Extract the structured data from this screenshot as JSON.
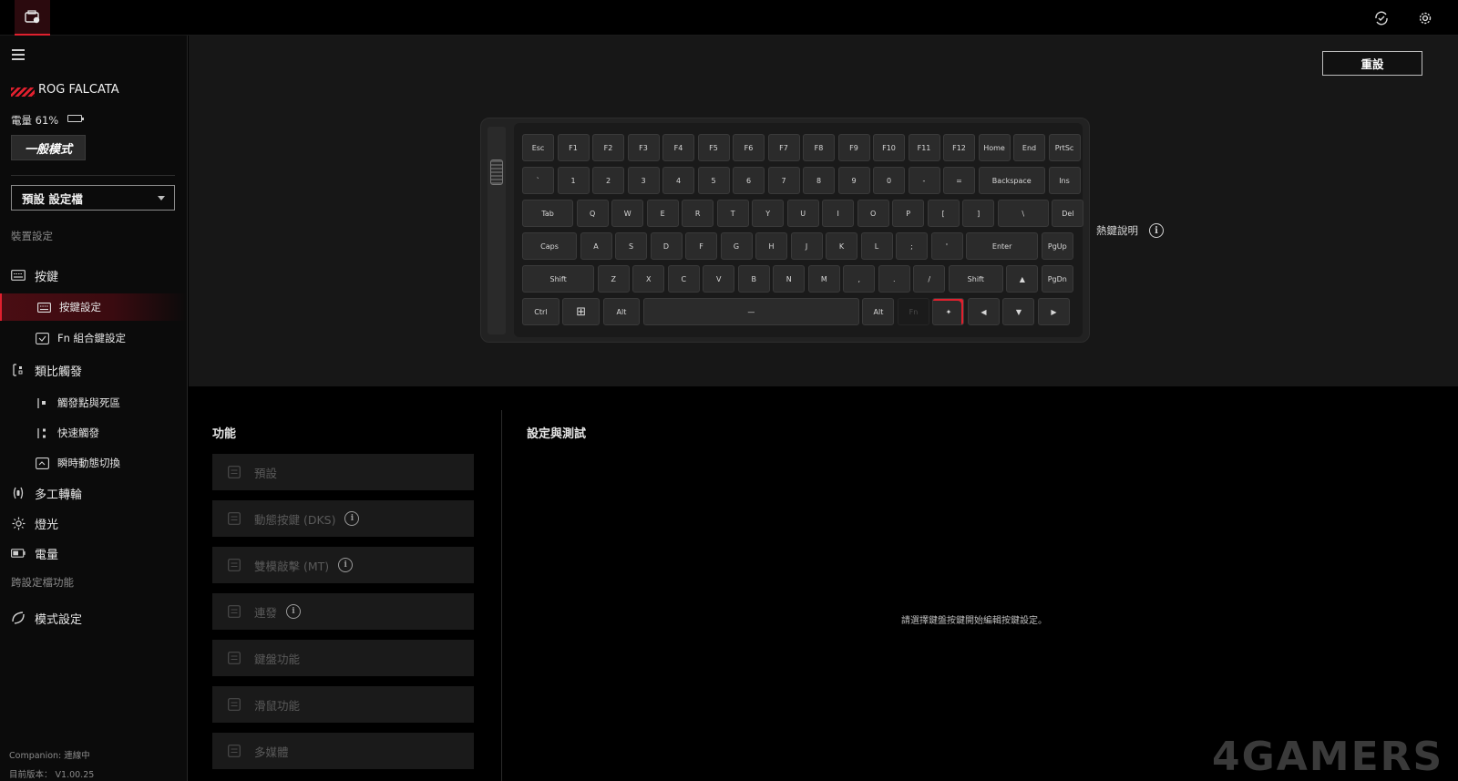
{
  "topbar": {
    "app_icon": "device-icon",
    "sync_icon": "sync-check-icon",
    "settings_icon": "gear-icon"
  },
  "sidebar": {
    "device_name": "ROG FALCATA",
    "battery_label": "電量 61%",
    "mode_button": "一般模式",
    "profile": "預設 設定檔",
    "section_device": "裝置設定",
    "nav": {
      "keys": "按鍵",
      "key_settings": "按鍵設定",
      "fn_combo": "Fn 組合鍵設定",
      "analog": "類比觸發",
      "trigger_deadzone": "觸發點與死區",
      "rapid_trigger": "快速觸發",
      "dynamic_switch": "瞬時動態切換",
      "multi_wheel": "多工轉輪",
      "lighting": "燈光",
      "power": "電量"
    },
    "section_cross": "跨設定檔功能",
    "mode_settings": "模式設定",
    "companion": "Companion: 連線中",
    "version": "目前版本： V1.00.25"
  },
  "keyboard": {
    "reset_label": "重設",
    "hotkey_help": "熱鍵說明",
    "rows": [
      [
        "Esc",
        "F1",
        "F2",
        "F3",
        "F4",
        "F5",
        "F6",
        "F7",
        "F8",
        "F9",
        "F10",
        "F11",
        "F12",
        "Home",
        "End",
        "PrtSc"
      ],
      [
        "`",
        "1",
        "2",
        "3",
        "4",
        "5",
        "6",
        "7",
        "8",
        "9",
        "0",
        "-",
        "=",
        "Backspace",
        "Ins"
      ],
      [
        "Tab",
        "Q",
        "W",
        "E",
        "R",
        "T",
        "Y",
        "U",
        "I",
        "O",
        "P",
        "[",
        "]",
        "\\",
        "Del"
      ],
      [
        "Caps",
        "A",
        "S",
        "D",
        "F",
        "G",
        "H",
        "J",
        "K",
        "L",
        ";",
        "'",
        "Enter",
        "PgUp"
      ],
      [
        "Shift",
        "Z",
        "X",
        "C",
        "V",
        "B",
        "N",
        "M",
        ",",
        ".",
        "/",
        "Shift",
        "▲",
        "PgDn"
      ],
      [
        "Ctrl",
        "⊞",
        "Alt",
        "—",
        "Alt",
        "Fn",
        "✦",
        "◀",
        "▼",
        "▶"
      ]
    ]
  },
  "functions": {
    "title": "功能",
    "items": [
      {
        "label": "預設",
        "icon": "default-icon",
        "info": false
      },
      {
        "label": "動態按鍵 (DKS)",
        "icon": "dks-icon",
        "info": true
      },
      {
        "label": "雙模敲擊 (MT)",
        "icon": "mt-icon",
        "info": true
      },
      {
        "label": "連發",
        "icon": "turbo-icon",
        "info": true
      },
      {
        "label": "鍵盤功能",
        "icon": "keyboard-icon",
        "info": false
      },
      {
        "label": "滑鼠功能",
        "icon": "mouse-icon",
        "info": false
      },
      {
        "label": "多媒體",
        "icon": "multimedia-icon",
        "info": false
      }
    ]
  },
  "settings": {
    "title": "設定與測試",
    "hint": "請選擇鍵盤按鍵開始編輯按鍵設定。"
  },
  "watermark": "4GAMERS",
  "colors": {
    "accent": "#e0202e",
    "background": "#000000",
    "panel": "#171717"
  }
}
